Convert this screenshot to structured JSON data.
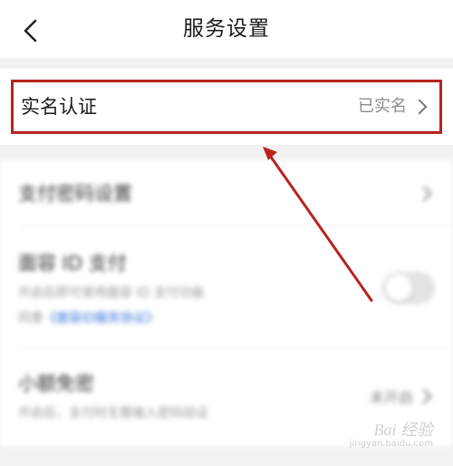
{
  "header": {
    "title": "服务设置",
    "back_icon": "chevron-left-icon"
  },
  "realname": {
    "label": "实名认证",
    "value": "已实名"
  },
  "rows": {
    "pay_password": {
      "title": "支付密码设置"
    },
    "face_id": {
      "title": "面容 ID 支付",
      "desc1": "开启后即可使用面容 ID 支付功能",
      "desc2_prefix": "同意",
      "desc2_link": "《面容ID服务协议》"
    },
    "small_free": {
      "title": "小额免密",
      "desc": "开启后，支付时无需输入密码验证",
      "value": "未开启"
    }
  },
  "watermark": {
    "text": "Bai 经验",
    "sub": "jingyan.baidu.com"
  },
  "colors": {
    "highlight": "#b8231f",
    "link": "#2f6fd6"
  }
}
